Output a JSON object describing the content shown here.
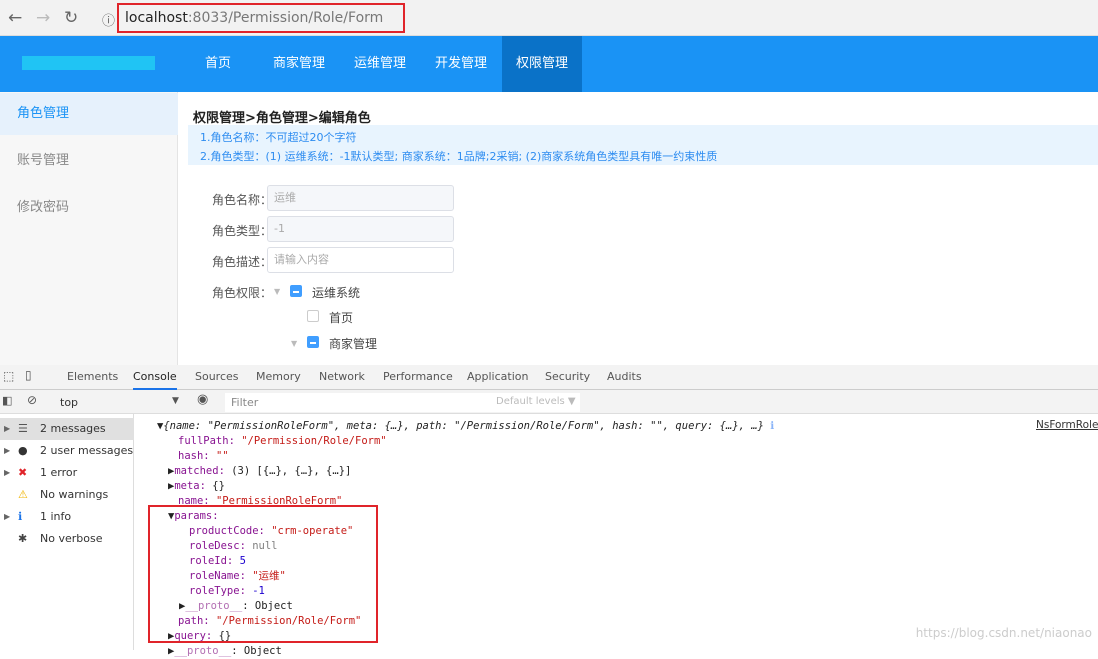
{
  "browser": {
    "url_host": "localhost",
    "url_rest": ":8033/Permission/Role/Form"
  },
  "nav": [
    {
      "label": "首页"
    },
    {
      "label": "商家管理"
    },
    {
      "label": "运维管理"
    },
    {
      "label": "开发管理"
    },
    {
      "label": "权限管理"
    }
  ],
  "sidebar": [
    {
      "label": "角色管理"
    },
    {
      "label": "账号管理"
    },
    {
      "label": "修改密码"
    }
  ],
  "breadcrumb": "权限管理>角色管理>编辑角色",
  "tips": [
    "1.角色名称：不可超过20个字符",
    "2.角色类型：(1) 运维系统：-1默认类型; 商家系统：1品牌;2采销; (2)商家系统角色类型具有唯一约束性质"
  ],
  "form": {
    "name_label": "角色名称：",
    "name_value": "运维",
    "type_label": "角色类型：",
    "type_value": "-1",
    "desc_label": "角色描述：",
    "desc_placeholder": "请输入内容",
    "perm_label": "角色权限：",
    "tree": [
      "运维系统",
      "首页",
      "商家管理"
    ]
  },
  "devtools": {
    "tabs": [
      "Elements",
      "Console",
      "Sources",
      "Memory",
      "Network",
      "Performance",
      "Application",
      "Security",
      "Audits"
    ],
    "context": "top",
    "filter_placeholder": "Filter",
    "levels": "Default levels ▼",
    "sidebar": [
      "2 messages",
      "2 user messages",
      "1 error",
      "No warnings",
      "1 info",
      "No verbose"
    ],
    "source_link": "NsFormRole",
    "lines": {
      "l0a": "{name: ",
      "l0b": "\"PermissionRoleForm\"",
      "l0c": ", meta: {…}, path: ",
      "l0d": "\"/Permission/Role/Form\"",
      "l0e": ", hash: ",
      "l0f": "\"\"",
      "l0g": ", query: {…}, …}",
      "fullPath_k": "fullPath: ",
      "fullPath_v": "\"/Permission/Role/Form\"",
      "hash_k": "hash: ",
      "hash_v": "\"\"",
      "matched_k": "matched: ",
      "matched_v": "(3) [{…}, {…}, {…}]",
      "meta_k": "meta: ",
      "meta_v": "{}",
      "name_k": "name: ",
      "name_v": "\"PermissionRoleForm\"",
      "params_k": "params:",
      "pc_k": "productCode: ",
      "pc_v": "\"crm-operate\"",
      "rd_k": "roleDesc: ",
      "rd_v": "null",
      "ri_k": "roleId: ",
      "ri_v": "5",
      "rn_k": "roleName: ",
      "rn_v": "\"运维\"",
      "rt_k": "roleType: ",
      "rt_v": "-1",
      "proto_k": "__proto__",
      "proto_v": ": Object",
      "path_k": "path: ",
      "path_v": "\"/Permission/Role/Form\"",
      "query_k": "query: ",
      "query_v": "{}"
    }
  },
  "watermark": "https://blog.csdn.net/niaonao"
}
